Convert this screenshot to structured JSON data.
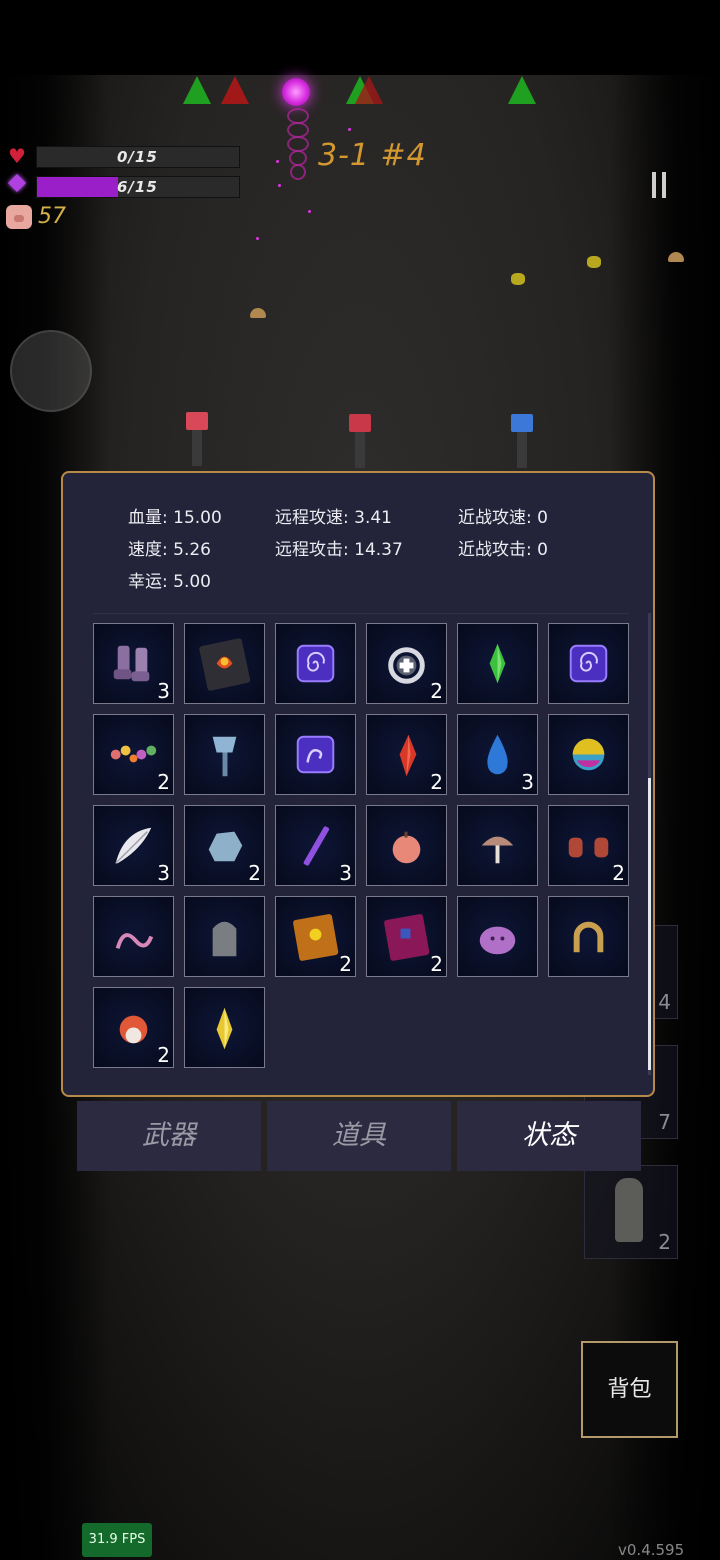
{
  "hud": {
    "health": "0/15",
    "health_fraction": 0.0,
    "mana": "6/15",
    "mana_fraction": 0.4,
    "coins": "57",
    "stage": "3-1 #4"
  },
  "stats": {
    "hp_label": "血量:",
    "hp_value": "15.00",
    "speed_label": "速度:",
    "speed_value": "5.26",
    "luck_label": "幸运:",
    "luck_value": "5.00",
    "ranged_speed_label": "远程攻速:",
    "ranged_speed_value": "3.41",
    "ranged_attack_label": "远程攻击:",
    "ranged_attack_value": "14.37",
    "melee_speed_label": "近战攻速:",
    "melee_speed_value": "0",
    "melee_attack_label": "近战攻击:",
    "melee_attack_value": "0"
  },
  "items": [
    {
      "icon": "boots-icon",
      "qty": "3"
    },
    {
      "icon": "fire-spellbook-icon",
      "qty": ""
    },
    {
      "icon": "spiral-rune-icon",
      "qty": ""
    },
    {
      "icon": "healing-ring-icon",
      "qty": "2"
    },
    {
      "icon": "green-crystal-icon",
      "qty": ""
    },
    {
      "icon": "spiral-rune-icon",
      "qty": ""
    },
    {
      "icon": "flower-crown-icon",
      "qty": "2"
    },
    {
      "icon": "ice-axe-icon",
      "qty": ""
    },
    {
      "icon": "hook-rune-icon",
      "qty": ""
    },
    {
      "icon": "red-crystal-icon",
      "qty": "2"
    },
    {
      "icon": "water-drop-icon",
      "qty": "3"
    },
    {
      "icon": "rainbow-orb-icon",
      "qty": ""
    },
    {
      "icon": "feather-icon",
      "qty": "3"
    },
    {
      "icon": "ice-rock-icon",
      "qty": "2"
    },
    {
      "icon": "purple-wand-icon",
      "qty": "3"
    },
    {
      "icon": "peach-icon",
      "qty": ""
    },
    {
      "icon": "mushroom-icon",
      "qty": ""
    },
    {
      "icon": "red-gloves-icon",
      "qty": "2"
    },
    {
      "icon": "worm-icon",
      "qty": ""
    },
    {
      "icon": "gravestone-icon",
      "qty": ""
    },
    {
      "icon": "gold-tome-icon",
      "qty": "2"
    },
    {
      "icon": "purple-tome-icon",
      "qty": "2"
    },
    {
      "icon": "purple-slime-icon",
      "qty": ""
    },
    {
      "icon": "horseshoe-icon",
      "qty": ""
    },
    {
      "icon": "hedgehog-skull-icon",
      "qty": "2"
    },
    {
      "icon": "yellow-crystal-icon",
      "qty": ""
    }
  ],
  "tabs": [
    {
      "label": "武器",
      "active": false
    },
    {
      "label": "道具",
      "active": false
    },
    {
      "label": "状态",
      "active": true
    }
  ],
  "side_slots": [
    "4",
    "7",
    "2"
  ],
  "bag_button": "背包",
  "fps": "31.9 FPS",
  "version": "v0.4.595",
  "colors": {
    "panel_bg": "#232339",
    "panel_border": "#b88a4a",
    "stage_text": "#d49830",
    "mana": "#9b1fc8"
  }
}
